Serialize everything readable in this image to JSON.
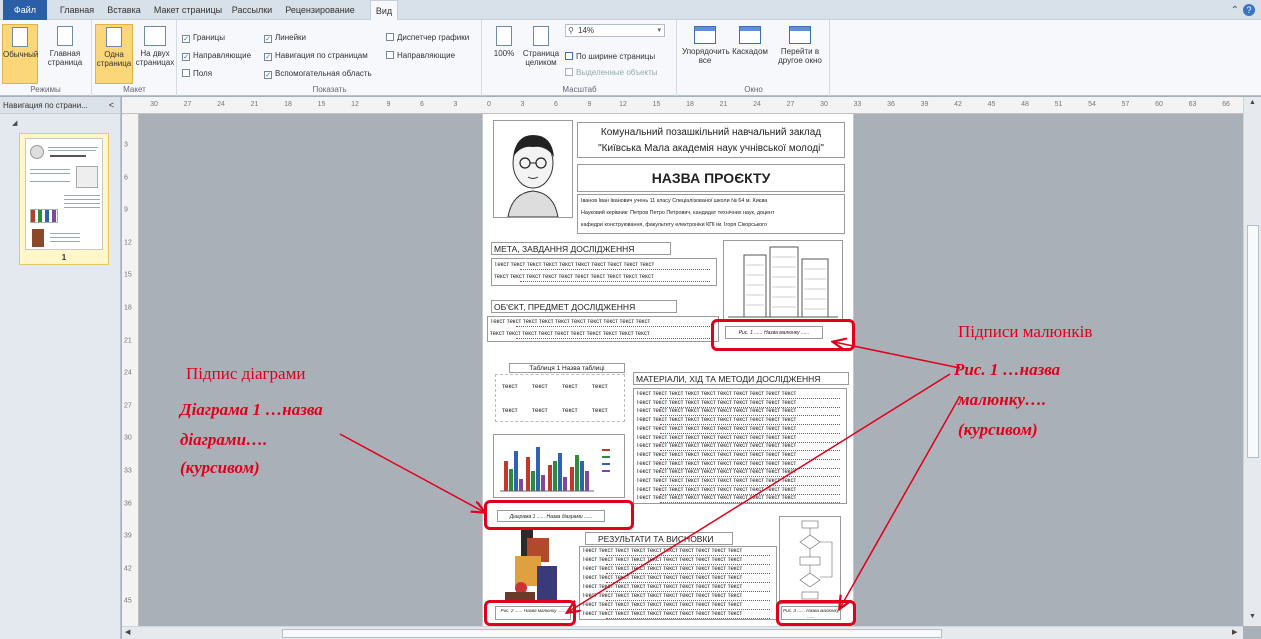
{
  "ribbon_tabs": [
    "Файл",
    "Главная",
    "Вставка",
    "Макет страницы",
    "Рассылки",
    "Рецензирование",
    "Вид"
  ],
  "active_tab": "Вид",
  "groups": {
    "modes": {
      "label": "Режимы",
      "normal": "Обычный",
      "master_1": "Главная",
      "master_2": "страница"
    },
    "layout": {
      "label": "Макет",
      "one_1": "Одна",
      "one_2": "страница",
      "two_1": "На двух",
      "two_2": "страницах"
    },
    "show": {
      "label": "Показать",
      "items": [
        {
          "text": "Границы",
          "checked": true
        },
        {
          "text": "Направляющие",
          "checked": true
        },
        {
          "text": "Поля",
          "checked": false
        },
        {
          "text": "Линейки",
          "checked": true
        },
        {
          "text": "Навигация по страницам",
          "checked": true
        },
        {
          "text": "Вспомогательная область",
          "checked": true
        },
        {
          "text": "Диспетчер графики",
          "checked": false
        },
        {
          "text": "Направляющие",
          "checked": false
        }
      ]
    },
    "zoom": {
      "label": "Масштаб",
      "btn100": "100%",
      "page_1": "Страница",
      "page_2": "целиком",
      "zoom_value": "14%",
      "page_width": "По ширине страницы",
      "selected_objects": "Выделенные объекты"
    },
    "window": {
      "label": "Окно",
      "arrange_1": "Упорядочить",
      "arrange_2": "все",
      "cascade": "Каскадом",
      "switch_1": "Перейти в",
      "switch_2": "другое окно"
    }
  },
  "nav": {
    "title": "Навигация по страни...",
    "page_number": "1"
  },
  "ruler": {
    "h_ticks": [
      "30",
      "27",
      "24",
      "21",
      "18",
      "15",
      "12",
      "9",
      "6",
      "3",
      "0",
      "3",
      "6",
      "9",
      "12",
      "15",
      "18",
      "21",
      "24",
      "27",
      "30",
      "33",
      "36",
      "39",
      "42",
      "45",
      "48",
      "51",
      "54",
      "57",
      "60",
      "63",
      "66"
    ],
    "v_ticks": [
      "3",
      "6",
      "9",
      "12",
      "15",
      "18",
      "21",
      "24",
      "27",
      "30",
      "33",
      "36",
      "39",
      "42",
      "45"
    ]
  },
  "poster": {
    "org_line1": "Комунальний позашкільний навчальний заклад",
    "org_line2": "\"Київська Мала академія наук учнівської молоді\"",
    "project_title": "НАЗВА ПРОЄКТУ",
    "author_line1": "Іванов Іван Іванович учень 11 класу Спеціалізованої школи № 64 м. Києва",
    "author_line2": "Науковий керівник: Петров Петро Петрович, кандидат технічних наук, доцент",
    "author_line3": "кафедри конструювання, факультету електроніки КПІ ім. Ігоря Сікорського",
    "sec_goal": "МЕТА, ЗАВДАННЯ ДОСЛІДЖЕННЯ",
    "sec_object": "ОБ'ЄКТ, ПРЕДМЕТ ДОСЛІДЖЕННЯ",
    "sec_materials": "МАТЕРІАЛИ, ХІД ТА МЕТОДИ ДОСЛІДЖЕННЯ",
    "sec_results": "РЕЗУЛЬТАТИ ТА ВИСНОВКИ",
    "text_line": "Текст текст текст текст текст текст текст текст текст текст",
    "text_line_lower": "текст текст текст текст текст текст текст текст текст текст",
    "table_title": "Таблиця 1 Назва таблиці",
    "table_cell": "текст",
    "fig1_caption": "Рис. 1 ...... Назва малюнку ......",
    "diag_caption": "Діаграма 1 ...... Назва діаграми ......",
    "fig2_caption": "Рис. 2 ...... Назва малюнку ......",
    "fig3_caption": "Рис. 3 ...... Назва малюнку ......"
  },
  "annotations": {
    "diagram_heading": "Підпис діаграми",
    "diagram_l1": "Діаграма  1 …назва",
    "diagram_l2": "діаграми….",
    "diagram_l3": "(курсивом)",
    "figure_heading": "Підписи малюнків",
    "figure_l1": "Рис. 1 …назва",
    "figure_l2": "малюнку….",
    "figure_l3": "(курсивом)"
  },
  "chart_colors": {
    "red": "#c0392b",
    "green": "#2e8b3a",
    "blue": "#2f62b3",
    "purple": "#7b4aa0"
  },
  "accent": "#e0001b"
}
